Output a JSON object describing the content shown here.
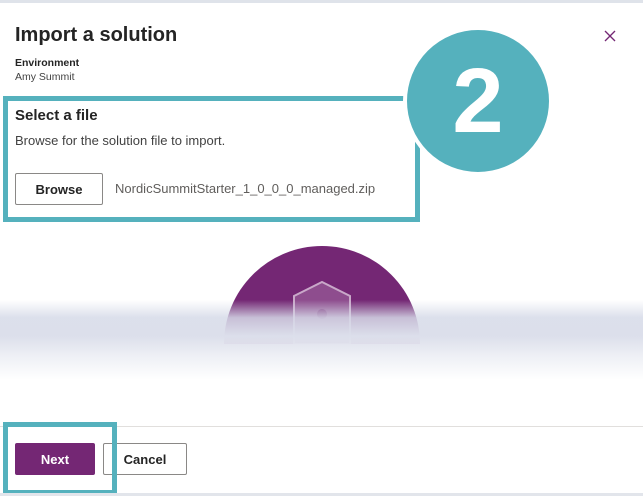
{
  "dialog": {
    "title": "Import a solution",
    "close_icon": "close-icon",
    "environment_label": "Environment",
    "environment_value": "Amy Summit"
  },
  "file_section": {
    "title": "Select a file",
    "description": "Browse for the solution file to import.",
    "browse_label": "Browse",
    "file_name": "NordicSummitStarter_1_0_0_0_managed.zip"
  },
  "callout": {
    "step": "2",
    "color": "#55b1bd"
  },
  "illustration": {
    "icon": "shield-icon",
    "circle_color": "#742774"
  },
  "footer": {
    "next_label": "Next",
    "cancel_label": "Cancel",
    "primary_color": "#742774"
  }
}
